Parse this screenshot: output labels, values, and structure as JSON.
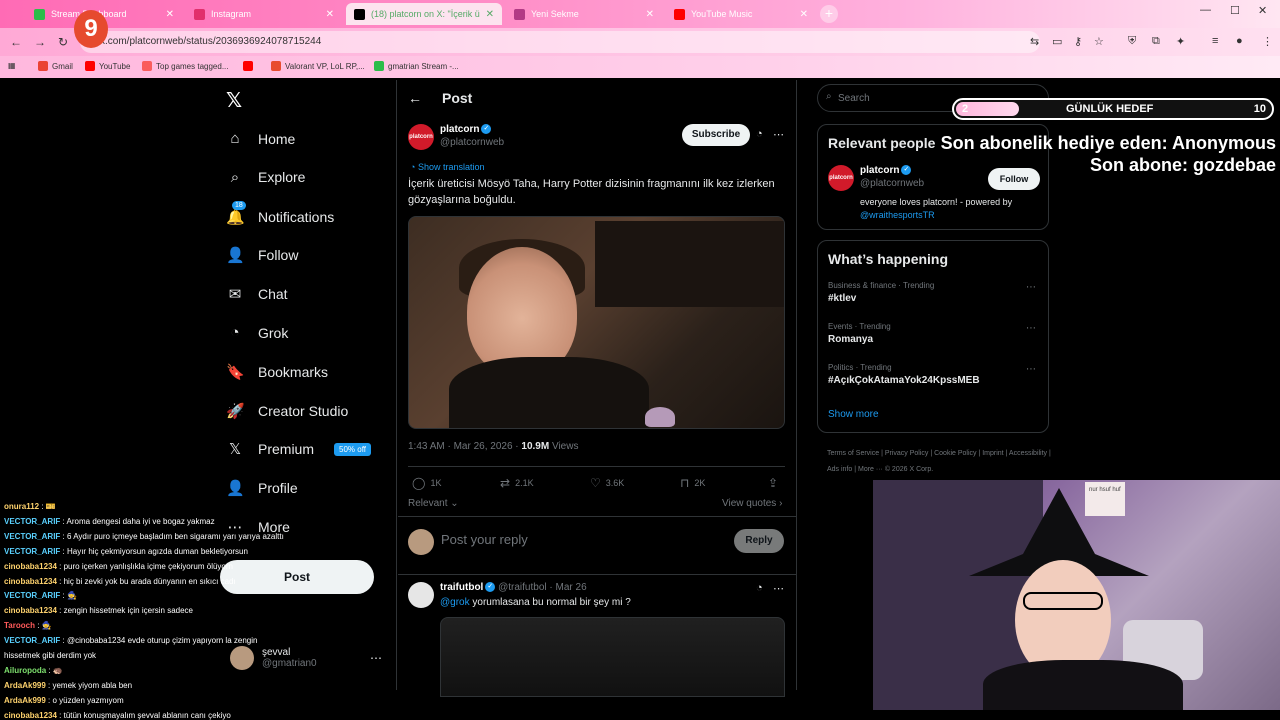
{
  "browser": {
    "tabs": [
      {
        "title": "Stream Dashboard",
        "fav": "#2bbd4a"
      },
      {
        "title": "Instagram",
        "fav": "#e1306c"
      },
      {
        "title": "(18) platcorn on X: \"İçerik ü",
        "fav": "#000000",
        "active": true
      },
      {
        "title": "Yeni Sekme",
        "fav": "#b23a85"
      },
      {
        "title": "YouTube Music",
        "fav": "#ff0000"
      }
    ],
    "url": "x.com/platcornweb/status/2036936924078715244",
    "bookmarks": [
      {
        "label": "Gmail",
        "fav": "#ea4335"
      },
      {
        "label": "YouTube",
        "fav": "#ff0000"
      },
      {
        "label": "Top games tagged...",
        "fav": "#fa5c5c"
      },
      {
        "label": "",
        "fav": "#ff0000"
      },
      {
        "label": "Valorant VP, LoL RP,...",
        "fav": "#e84c2f"
      },
      {
        "label": "gmatrian Stream -...",
        "fav": "#2bbd4a"
      }
    ]
  },
  "x": {
    "nav": [
      {
        "label": "Home",
        "icon": "home-icon",
        "glyph": "⌂"
      },
      {
        "label": "Explore",
        "icon": "search-icon",
        "glyph": "⌕"
      },
      {
        "label": "Notifications",
        "icon": "bell-icon",
        "glyph": "🔔",
        "badge": "18"
      },
      {
        "label": "Follow",
        "icon": "person-plus-icon",
        "glyph": "👤"
      },
      {
        "label": "Chat",
        "icon": "mail-icon",
        "glyph": "✉"
      },
      {
        "label": "Grok",
        "icon": "grok-icon",
        "glyph": "◔"
      },
      {
        "label": "Bookmarks",
        "icon": "bookmark-icon",
        "glyph": "🔖"
      },
      {
        "label": "Creator Studio",
        "icon": "rocket-icon",
        "glyph": "🚀"
      },
      {
        "label": "Premium",
        "icon": "x-logo-icon",
        "glyph": "𝕏",
        "pill": "50% off"
      },
      {
        "label": "Profile",
        "icon": "person-icon",
        "glyph": "👤"
      },
      {
        "label": "More",
        "icon": "more-icon",
        "glyph": "⋯"
      }
    ],
    "post_button": "Post",
    "account": {
      "name": "şevval",
      "handle": "@gmatrian0"
    },
    "header_title": "Post",
    "post": {
      "author_name": "platcorn",
      "author_handle": "@platcornweb",
      "avatar_text": "platcorn",
      "subscribe": "Subscribe",
      "show_translation": "Show translation",
      "text": "İçerik üreticisi Mösyö Taha, Harry Potter dizisinin fragmanını ilk kez izlerken gözyaşlarına boğuldu.",
      "time": "1:43 AM · Mar 26, 2026 · ",
      "views_count": "10.9M",
      "views_label": " Views",
      "replies": "1K",
      "reposts": "2.1K",
      "likes": "3.6K",
      "bookmarks": "2K",
      "relevant": "Relevant",
      "view_quotes": "View quotes"
    },
    "reply": {
      "placeholder": "Post your reply",
      "button": "Reply"
    },
    "comment": {
      "name": "traifutbol",
      "handle": "@traifutbol · Mar 26",
      "mention": "@grok",
      "text": " yorumlasana bu normal bir şey mi ?"
    },
    "search_placeholder": "Search",
    "relevant_people": {
      "title": "Relevant people",
      "name": "platcorn",
      "handle": "@platcornweb",
      "follow": "Follow",
      "bio": "everyone loves platcorn! - powered by",
      "bio_link": "@wraithesportsTR"
    },
    "whats_happening": {
      "title": "What’s happening",
      "trends": [
        {
          "category": "Business & finance · Trending",
          "title": "#ktlev"
        },
        {
          "category": "Events · Trending",
          "title": "Romanya"
        },
        {
          "category": "Politics · Trending",
          "title": "#AçıkÇokAtamaYok24KpssMEB"
        }
      ],
      "show_more": "Show more"
    },
    "footer": "Terms of Service  |  Privacy Policy  |  Cookie Policy  |  Imprint  |  Accessibility  |  Ads info  |  More ···  © 2026 X Corp."
  },
  "stream": {
    "logo_letter": "9",
    "goal": {
      "current": "2",
      "label": "GÜNLÜK HEDEF",
      "target": "10",
      "progress": 0.2
    },
    "gift_line": "Son abonelik hediye eden: Anonymous",
    "sub_line": "Son abone: gozdebae",
    "sign_text": "nur hsuf huf",
    "chat": [
      {
        "user": "onura112",
        "color": "#ffd36e",
        "text": " : 🎫"
      },
      {
        "user": "VECTOR_ARIF",
        "color": "#5ad1ff",
        "text": " : Aroma dengesi daha iyi ve bogaz yakmaz"
      },
      {
        "user": "VECTOR_ARIF",
        "color": "#5ad1ff",
        "text": " : 6 Aydır puro içmeye başladım ben sigaramı yarı yarıya azalttı"
      },
      {
        "user": "VECTOR_ARIF",
        "color": "#5ad1ff",
        "text": " : Hayır hiç çekmiyorsun agızda duman bekletiyorsun"
      },
      {
        "user": "cinobaba1234",
        "color": "#ffd36e",
        "text": " : puro içerken yanlışlıkla içime çekiyorum ölüyorn"
      },
      {
        "user": "cinobaba1234",
        "color": "#ffd36e",
        "text": " : hiç bi zevki yok bu arada dünyanın en sıkıcı cadı"
      },
      {
        "user": "VECTOR_ARIF",
        "color": "#5ad1ff",
        "text": " : 🧙"
      },
      {
        "user": "cinobaba1234",
        "color": "#ffd36e",
        "text": " : zengin hissetmek için içersin sadece"
      },
      {
        "user": "Tarooch",
        "color": "#ff5a5a",
        "text": " : 🧙"
      },
      {
        "user": "VECTOR_ARIF",
        "color": "#5ad1ff",
        "text": " : @cinobaba1234 evde oturup çizim yapıyorn la zengin"
      },
      {
        "user": "",
        "color": "#ffffff",
        "text": "hissetmek gibi derdim yok"
      },
      {
        "user": "Ailuropoda",
        "color": "#7ee06e",
        "text": " : 🦔"
      },
      {
        "user": "ArdaAk999",
        "color": "#ffd36e",
        "text": " : yemek yiyom abla ben"
      },
      {
        "user": "ArdaAk999",
        "color": "#ffd36e",
        "text": " : o yüzden yazmıyom"
      },
      {
        "user": "cinobaba1234",
        "color": "#ffd36e",
        "text": " : tütün konuşmayalım şevval ablanın canı çekiyo"
      }
    ]
  }
}
